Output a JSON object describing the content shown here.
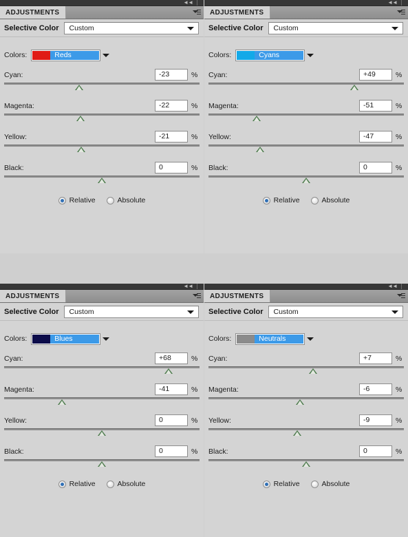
{
  "app": {
    "panel_tab_label": "ADJUSTMENTS",
    "adjustment_title": "Selective Color",
    "preset_value": "Custom",
    "colors_label": "Colors:",
    "percent_symbol": "%",
    "method_relative": "Relative",
    "method_absolute": "Absolute",
    "channel_labels": {
      "cyan": "Cyan:",
      "magenta": "Magenta:",
      "yellow": "Yellow:",
      "black": "Black:"
    },
    "accent_color": "#3c9ae8",
    "panel_bg": "#d4d4d4",
    "thumb_color": "#4d7a4d",
    "radio_dot_color": "#2f6fb5"
  },
  "panels": [
    {
      "id": "panel-reds",
      "tab_label": "ADJUSTMENTS",
      "title": "Selective Color",
      "preset": "Custom",
      "colors_label": "Colors:",
      "color_group": "Reds",
      "swatch_color": "#e01b15",
      "method": "Relative",
      "sliders": [
        {
          "name": "cyan",
          "label": "Cyan:",
          "value": "-23",
          "percent": "-23"
        },
        {
          "name": "magenta",
          "label": "Magenta:",
          "value": "-22",
          "percent": "-22"
        },
        {
          "name": "yellow",
          "label": "Yellow:",
          "value": "-21",
          "percent": "-21"
        },
        {
          "name": "black",
          "label": "Black:",
          "value": "0",
          "percent": "0"
        }
      ]
    },
    {
      "id": "panel-cyans",
      "tab_label": "ADJUSTMENTS",
      "title": "Selective Color",
      "preset": "Custom",
      "colors_label": "Colors:",
      "color_group": "Cyans",
      "swatch_color": "#13a9e8",
      "method": "Relative",
      "sliders": [
        {
          "name": "cyan",
          "label": "Cyan:",
          "value": "+49",
          "percent": "49"
        },
        {
          "name": "magenta",
          "label": "Magenta:",
          "value": "-51",
          "percent": "-51"
        },
        {
          "name": "yellow",
          "label": "Yellow:",
          "value": "-47",
          "percent": "-47"
        },
        {
          "name": "black",
          "label": "Black:",
          "value": "0",
          "percent": "0"
        }
      ]
    },
    {
      "id": "panel-blues",
      "tab_label": "ADJUSTMENTS",
      "title": "Selective Color",
      "preset": "Custom",
      "colors_label": "Colors:",
      "color_group": "Blues",
      "swatch_color": "#0c0c4a",
      "method": "Relative",
      "sliders": [
        {
          "name": "cyan",
          "label": "Cyan:",
          "value": "+68",
          "percent": "68"
        },
        {
          "name": "magenta",
          "label": "Magenta:",
          "value": "-41",
          "percent": "-41"
        },
        {
          "name": "yellow",
          "label": "Yellow:",
          "value": "0",
          "percent": "0"
        },
        {
          "name": "black",
          "label": "Black:",
          "value": "0",
          "percent": "0"
        }
      ]
    },
    {
      "id": "panel-neutrals",
      "tab_label": "ADJUSTMENTS",
      "title": "Selective Color",
      "preset": "Custom",
      "colors_label": "Colors:",
      "color_group": "Neutrals",
      "swatch_color": "#8b8b8b",
      "method": "Relative",
      "sliders": [
        {
          "name": "cyan",
          "label": "Cyan:",
          "value": "+7",
          "percent": "7"
        },
        {
          "name": "magenta",
          "label": "Magenta:",
          "value": "-6",
          "percent": "-6"
        },
        {
          "name": "yellow",
          "label": "Yellow:",
          "value": "-9",
          "percent": "-9"
        },
        {
          "name": "black",
          "label": "Black:",
          "value": "0",
          "percent": "0"
        }
      ]
    }
  ]
}
